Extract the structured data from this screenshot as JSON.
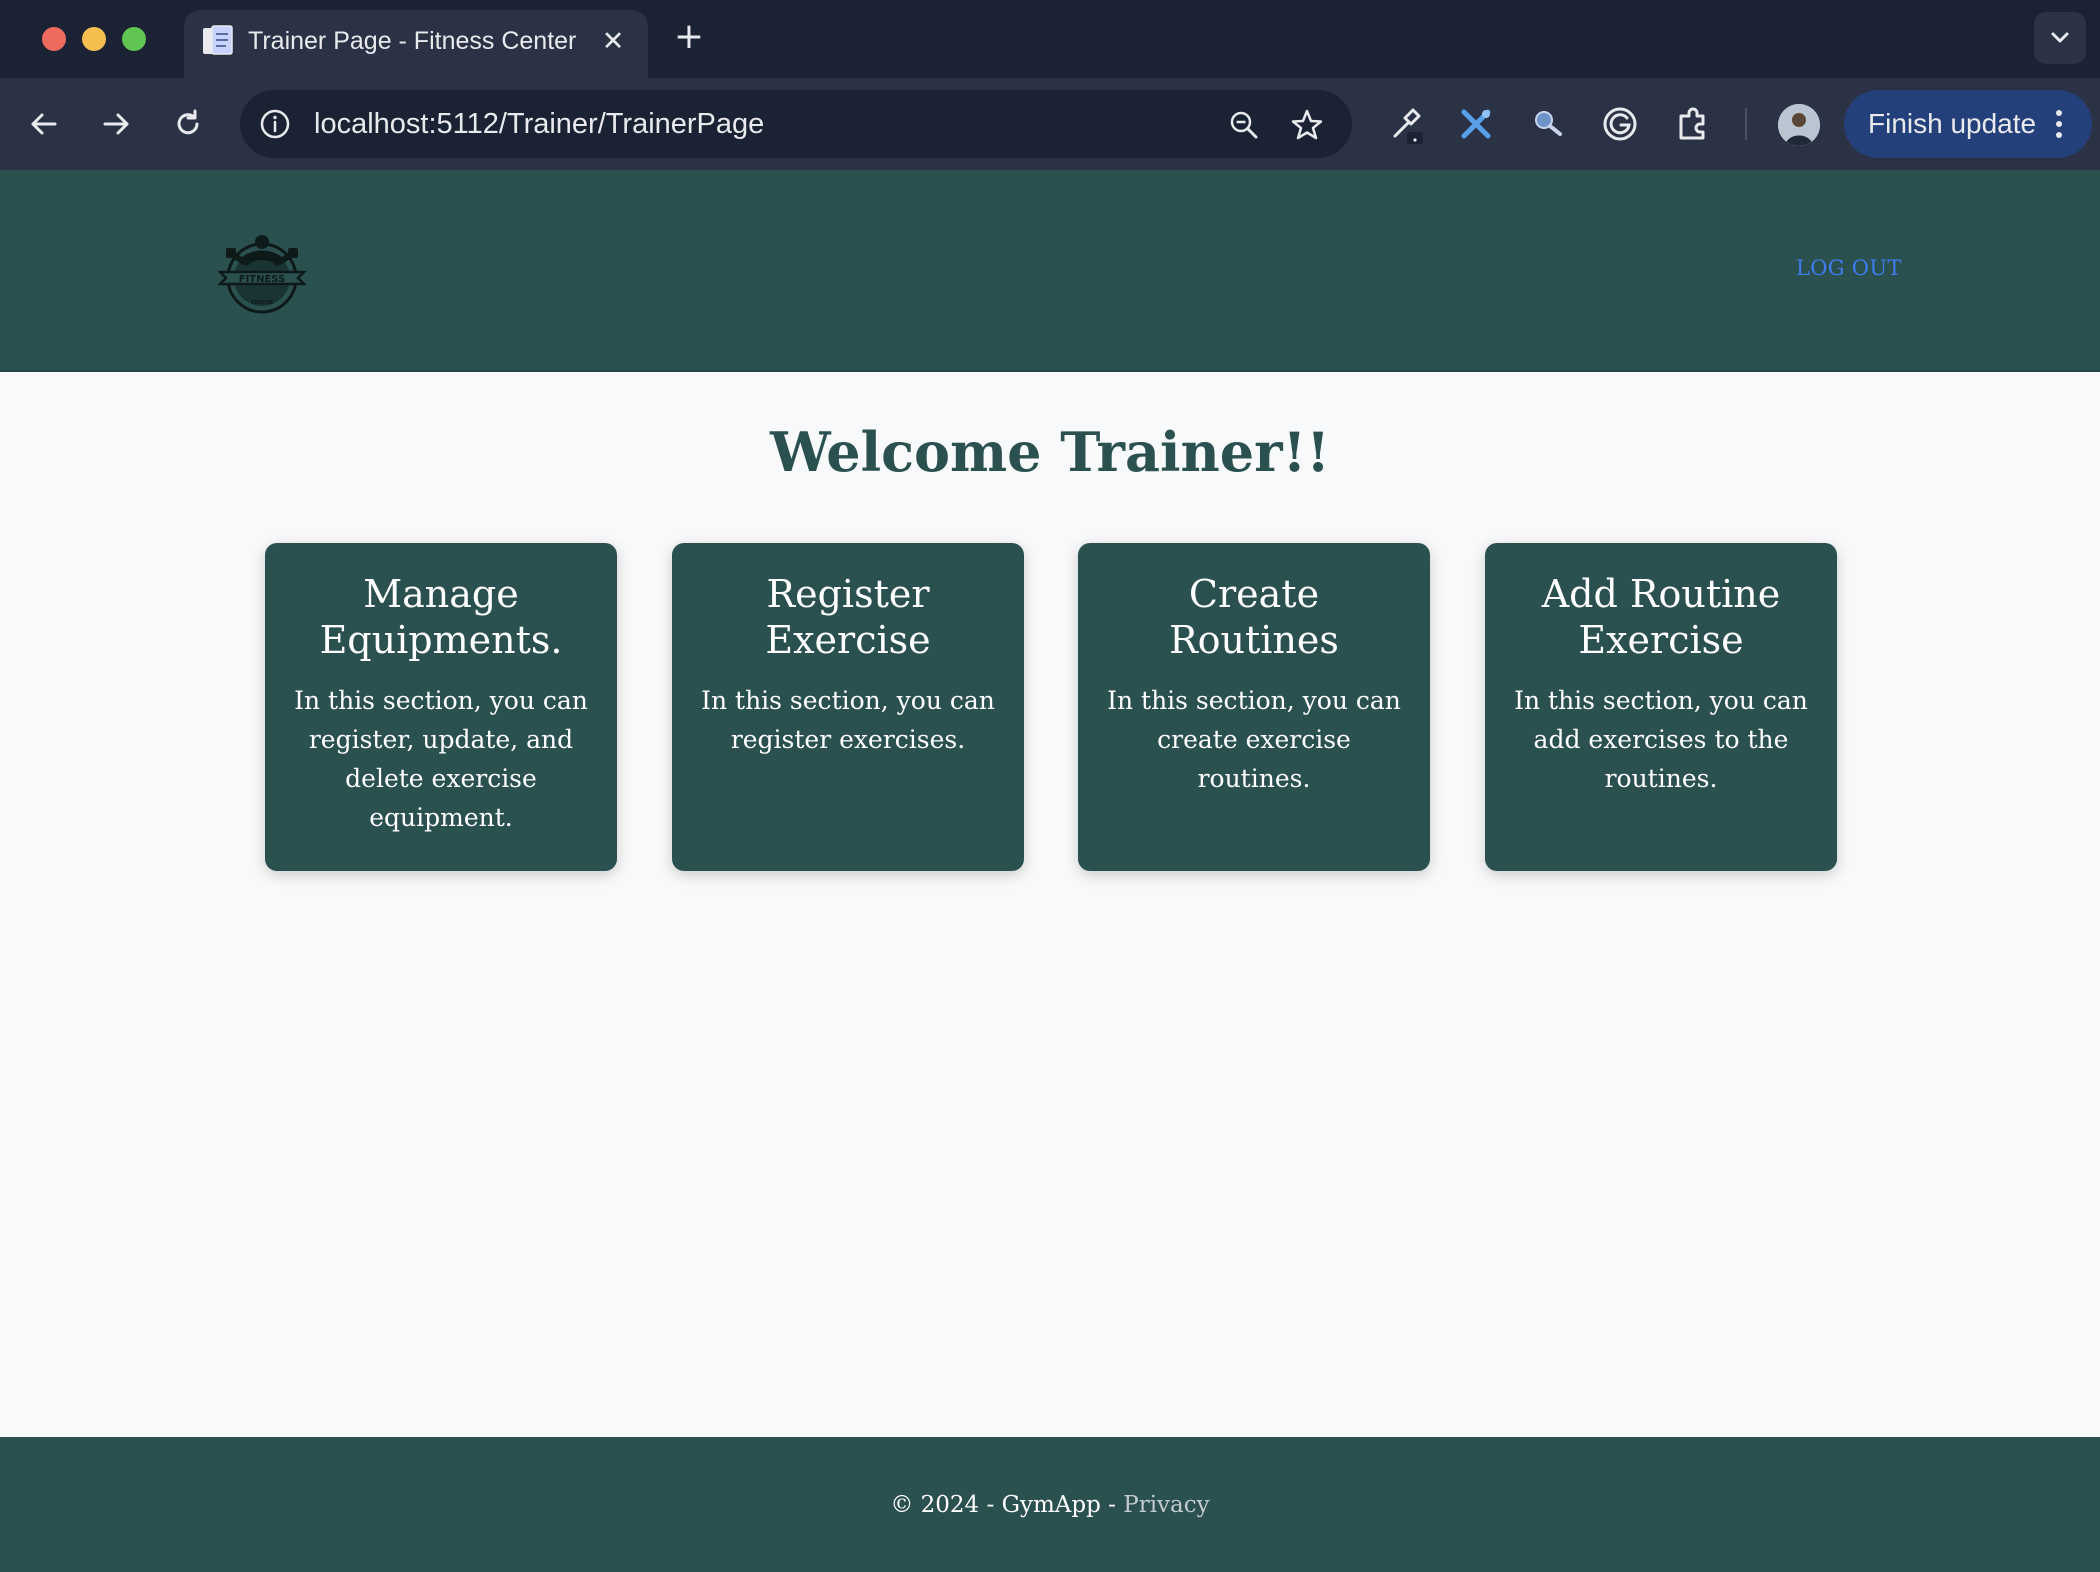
{
  "browser": {
    "tab": {
      "title": "Trainer Page - Fitness Center",
      "favicon": "document-icon"
    },
    "address_bar": {
      "url": "localhost:5112/Trainer/TrainerPage"
    },
    "update_button_label": "Finish update",
    "icons": [
      "back-arrow-icon",
      "forward-arrow-icon",
      "reload-icon",
      "site-info-icon",
      "zoom-out-icon",
      "bookmark-star-icon",
      "eyedropper-extension-icon",
      "tools-extension-icon",
      "search-extension-icon",
      "grammarly-extension-icon",
      "extensions-puzzle-icon",
      "more-vert-icon",
      "tab-search-chevron-icon"
    ]
  },
  "header": {
    "logo_text": "FITNESS",
    "logo_subtext": "CENTER",
    "logout_label": "LOG OUT"
  },
  "main": {
    "title": "Welcome Trainer!!",
    "cards": [
      {
        "title": "Manage Equipments.",
        "text": "In this section, you can register, update, and delete exercise equipment."
      },
      {
        "title": "Register Exercise",
        "text": "In this section, you can register exercises."
      },
      {
        "title": "Create Routines",
        "text": "In this section, you can create exercise routines."
      },
      {
        "title": "Add Routine Exercise",
        "text": "In this section, you can add exercises to the routines."
      }
    ]
  },
  "footer": {
    "copyright": "© 2024 - GymApp - ",
    "privacy_label": "Privacy"
  },
  "colors": {
    "brand": "#2b5050",
    "link": "#3f7cf0",
    "page_bg": "#f8f9fa"
  }
}
